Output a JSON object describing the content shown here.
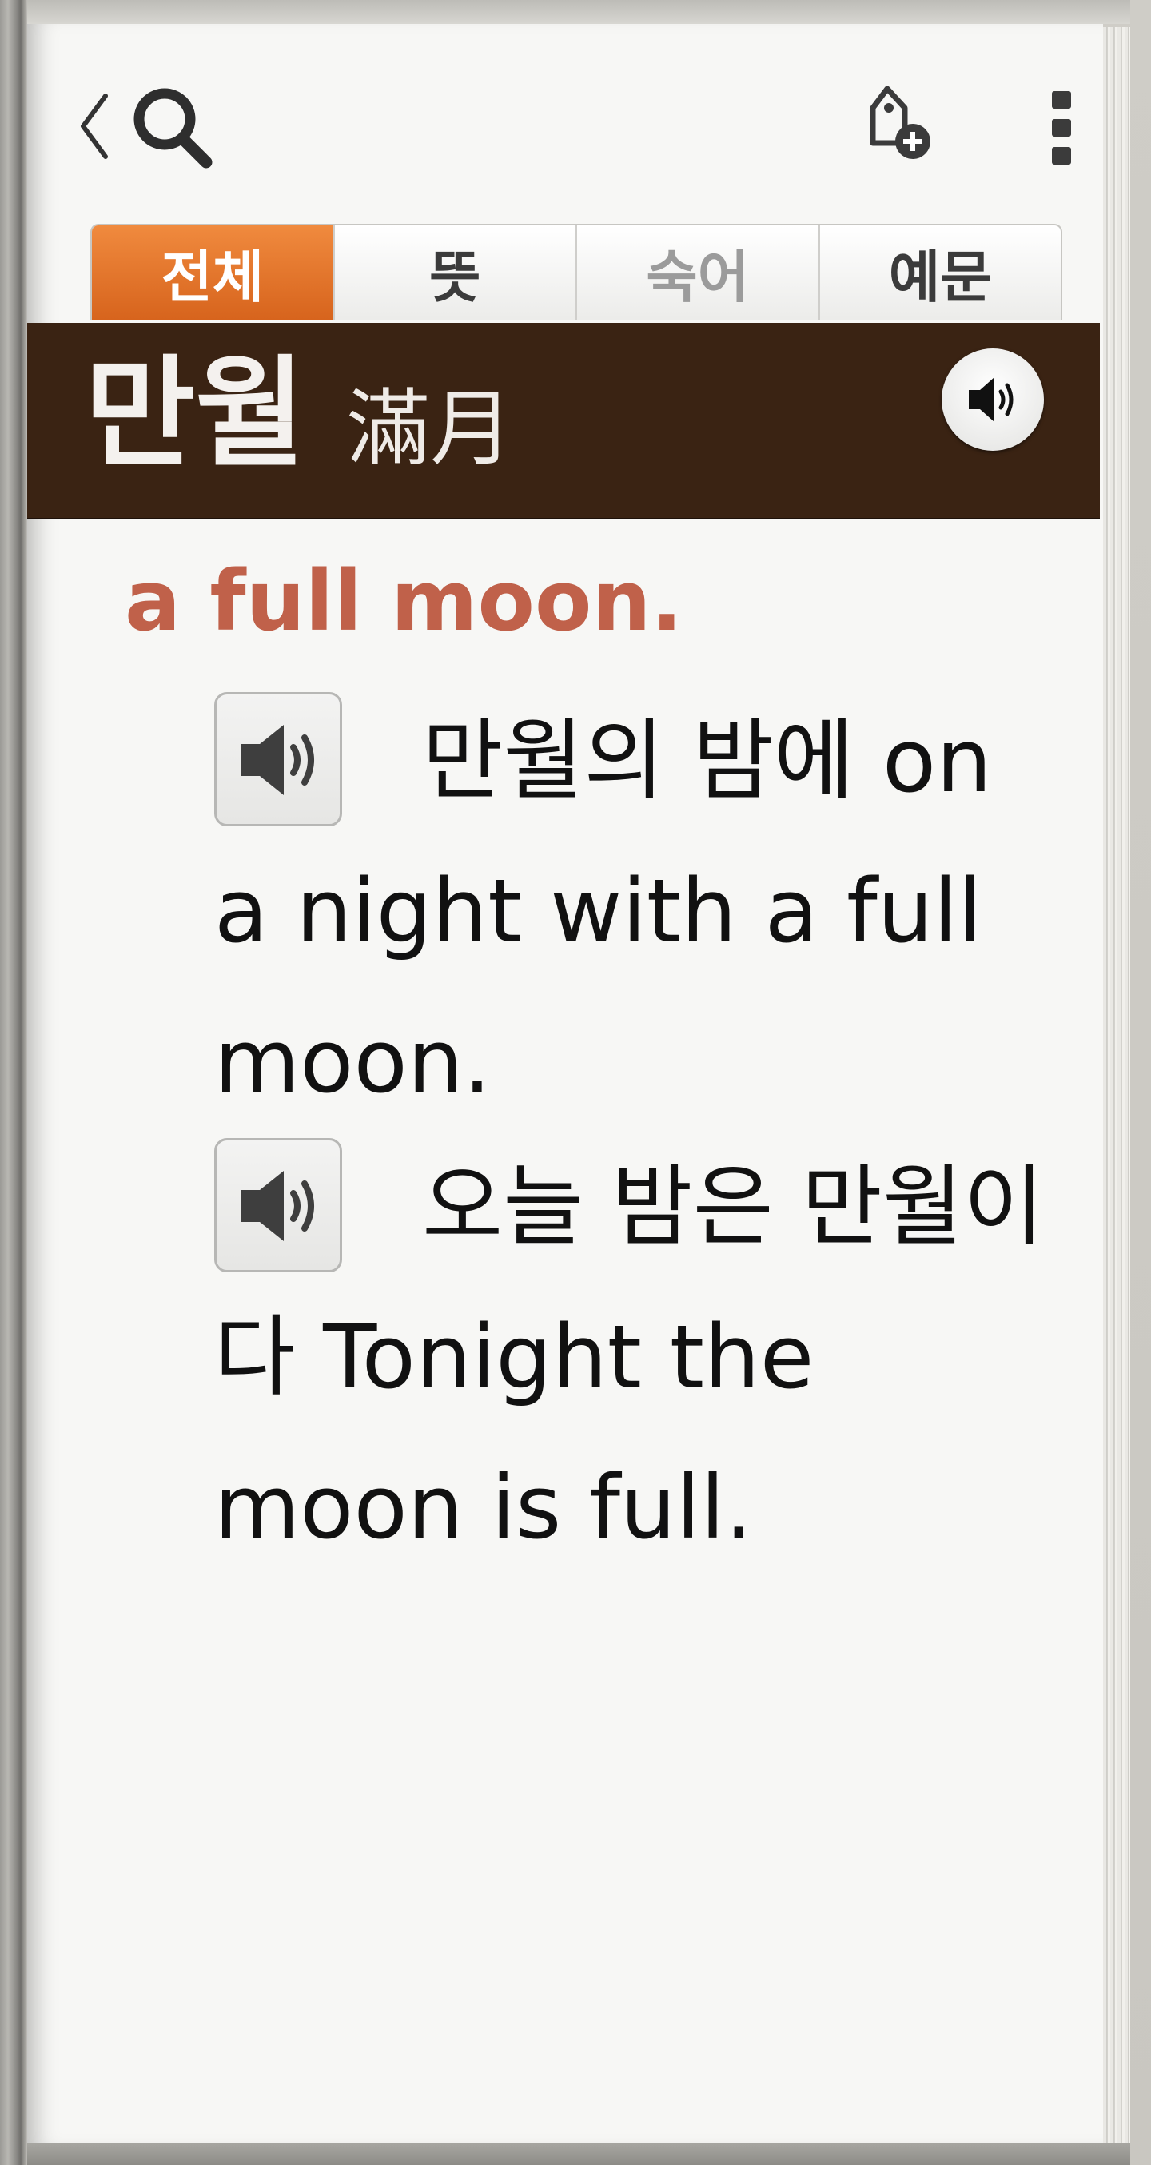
{
  "toolbar": {
    "back_icon": "chevron-left-icon",
    "search_icon": "search-icon",
    "add_tag_icon": "tag-add-icon",
    "more_icon": "more-vertical-icon"
  },
  "tabs": [
    {
      "label": "전체",
      "state": "active"
    },
    {
      "label": "뜻",
      "state": "normal"
    },
    {
      "label": "숙어",
      "state": "disabled"
    },
    {
      "label": "예문",
      "state": "normal"
    }
  ],
  "entry": {
    "headword": "만월",
    "hanja": "滿月",
    "definition": "a full moon."
  },
  "examples": [
    {
      "text": "만월의 밤에 on a night with a full moon."
    },
    {
      "text": "오늘 밤은 만월이다 Tonight the moon is full."
    }
  ],
  "colors": {
    "tab_active": "#e0712a",
    "header_bg": "#3a2313",
    "definition": "#c0614a"
  }
}
